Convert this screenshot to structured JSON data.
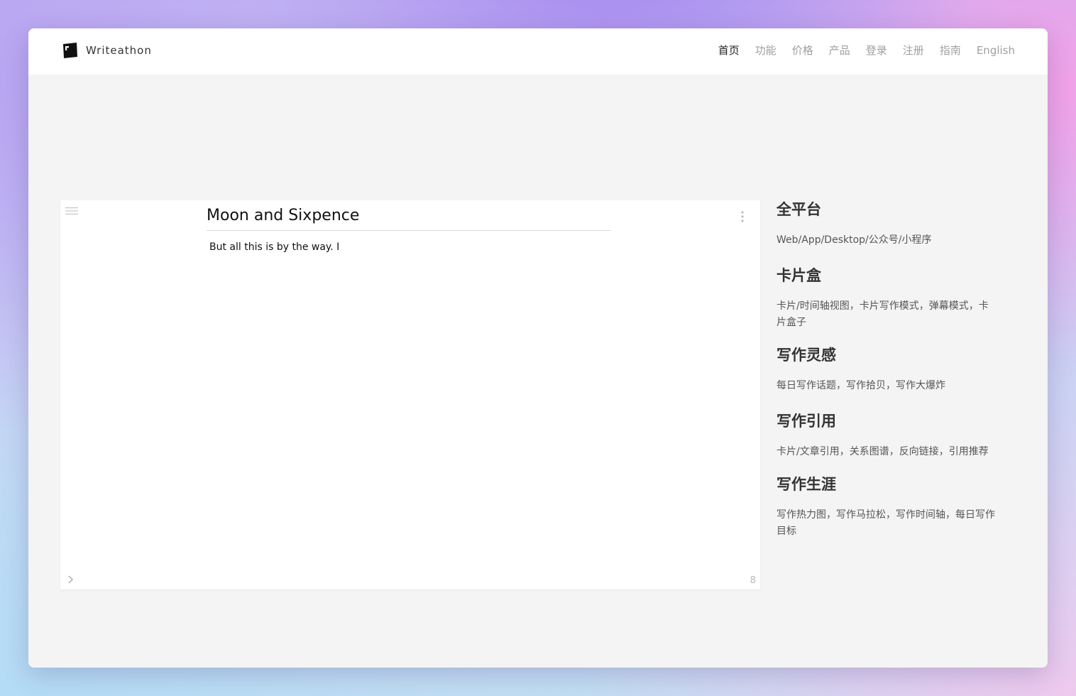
{
  "brand": {
    "name": "Writeathon"
  },
  "nav": {
    "items": [
      {
        "label": "首页"
      },
      {
        "label": "功能"
      },
      {
        "label": "价格"
      },
      {
        "label": "产品"
      },
      {
        "label": "登录"
      },
      {
        "label": "注册"
      },
      {
        "label": "指南"
      },
      {
        "label": "English"
      }
    ],
    "active_index": 0
  },
  "editor": {
    "title": "Moon and Sixpence",
    "body": "But all this is by the way. I",
    "word_count": "8"
  },
  "features": [
    {
      "title": "全平台",
      "desc": "Web/App/Desktop/公众号/小程序"
    },
    {
      "title": "卡片盒",
      "desc": "卡片/时间轴视图，卡片写作模式，弹幕模式，卡片盒子"
    },
    {
      "title": "写作灵感",
      "desc": "每日写作话题，写作拾贝，写作大爆炸"
    },
    {
      "title": "写作引用",
      "desc": "卡片/文章引用，关系图谱，反向链接，引用推荐"
    },
    {
      "title": "写作生涯",
      "desc": "写作热力图，写作马拉松，写作时间轴，每日写作目标"
    }
  ],
  "icons": {
    "logo": "writeathon-logo-icon",
    "menu": "hamburger-menu-icon",
    "more": "vertical-dots-icon",
    "expand": "chevron-right-icon"
  },
  "colors": {
    "window_bg": "#f4f4f4",
    "nav_active": "#222222",
    "nav_inactive": "#a0a0a0",
    "heading": "#333333"
  }
}
